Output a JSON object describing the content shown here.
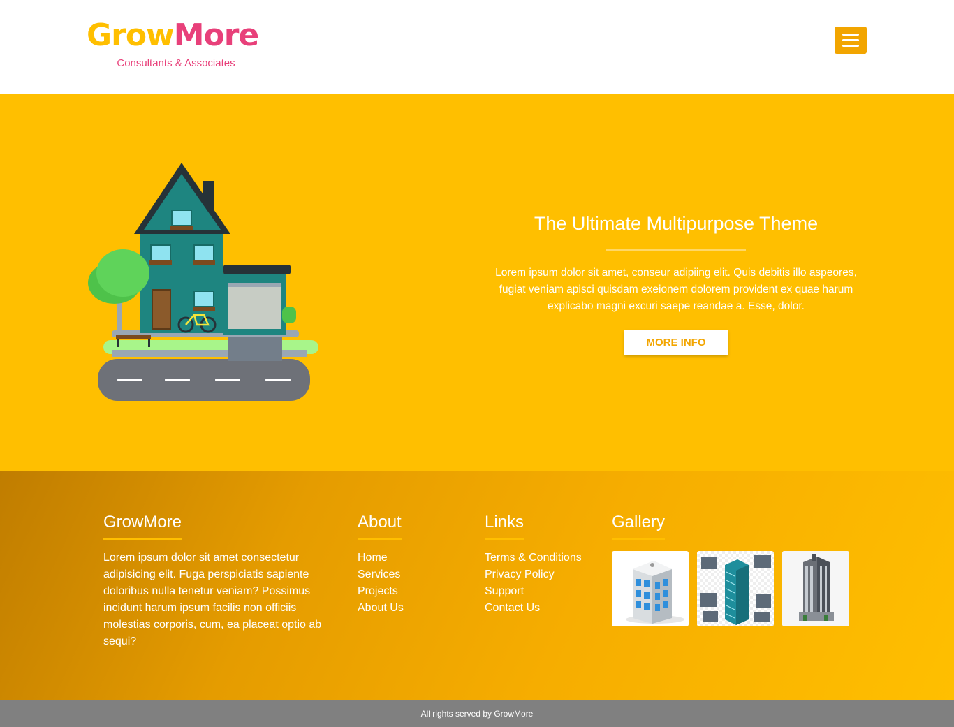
{
  "header": {
    "logo_part1": "Grow",
    "logo_part2": "More",
    "tagline": "Consultants & Associates",
    "menu_icon": "hamburger-icon"
  },
  "hero": {
    "illustration": "house-illustration",
    "title": "The Ultimate Multipurpose Theme",
    "body": "Lorem ipsum dolor sit amet, conseur adipiing elit. Quis debitis illo aspeores, fugiat veniam apisci quisdam exeionem dolorem provident ex quae harum explicabo magni excuri saepe reandae a. Esse, dolor.",
    "button_label": "MORE INFO"
  },
  "footer": {
    "about": {
      "title": "GrowMore",
      "text": "Lorem ipsum dolor sit amet consectetur adipisicing elit. Fuga perspiciatis sapiente doloribus nulla tenetur veniam? Possimus incidunt harum ipsum facilis non officiis molestias corporis, cum, ea placeat optio ab sequi?"
    },
    "about_links": {
      "title": "About",
      "items": [
        "Home",
        "Services",
        "Projects",
        "About Us"
      ]
    },
    "links": {
      "title": "Links",
      "items": [
        "Terms & Conditions",
        "Privacy Policy",
        "Support",
        "Contact Us"
      ]
    },
    "gallery": {
      "title": "Gallery",
      "images": [
        "office-building-image",
        "isometric-buildings-image",
        "skyscraper-image"
      ]
    }
  },
  "copyright": "All rights served by GrowMore",
  "colors": {
    "accent_yellow": "#ffbf00",
    "brand_pink": "#e8407a",
    "button_orange": "#f2a500",
    "bottom_bar": "#808080"
  }
}
